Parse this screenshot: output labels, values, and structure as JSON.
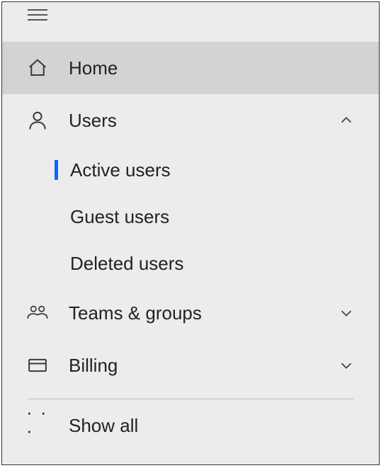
{
  "nav": {
    "home": {
      "label": "Home"
    },
    "users": {
      "label": "Users",
      "expanded": true,
      "items": [
        {
          "label": "Active users",
          "active": true
        },
        {
          "label": "Guest users",
          "active": false
        },
        {
          "label": "Deleted users",
          "active": false
        }
      ]
    },
    "teams": {
      "label": "Teams & groups",
      "expanded": false
    },
    "billing": {
      "label": "Billing",
      "expanded": false
    },
    "showall": {
      "label": "Show all"
    }
  }
}
